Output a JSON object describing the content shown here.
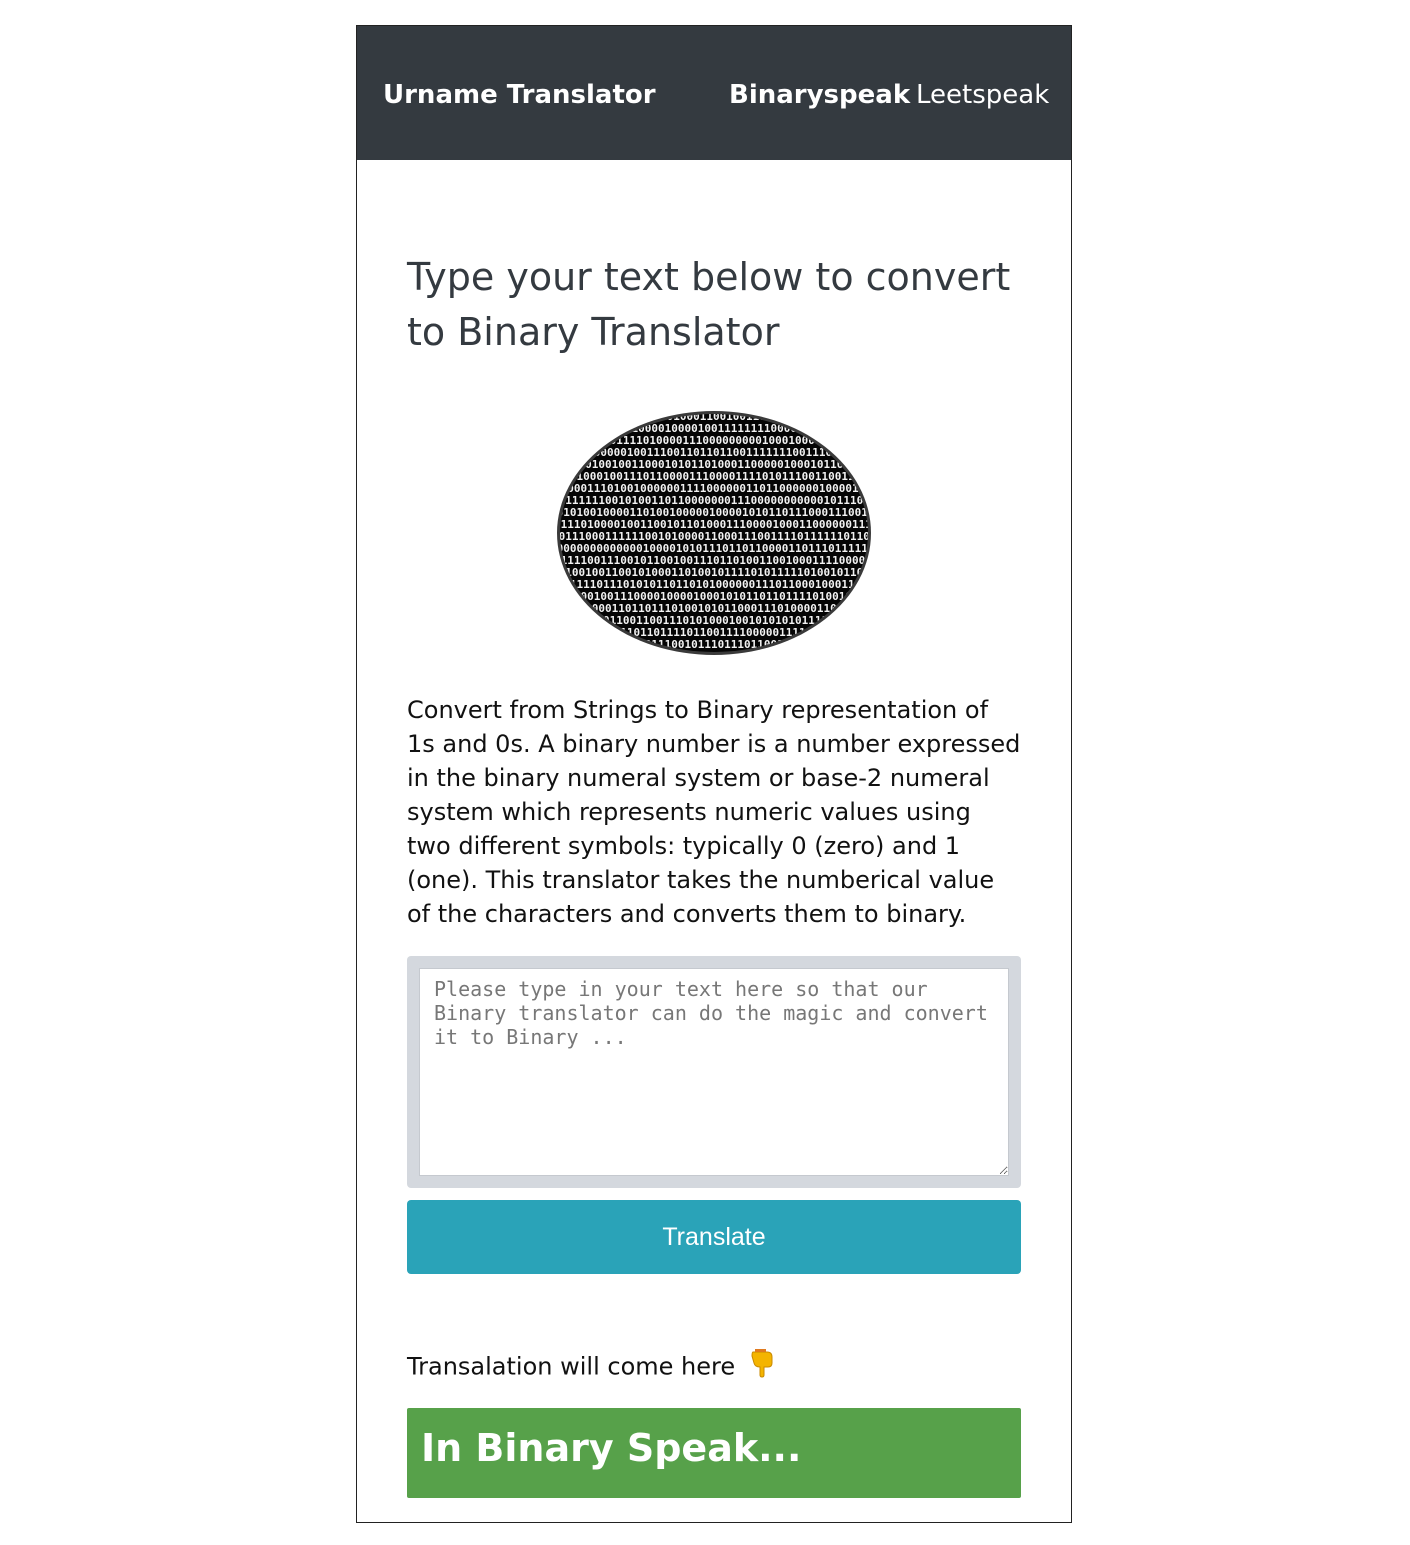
{
  "navbar": {
    "brand": "Urname Translator",
    "links": [
      {
        "label": "Binaryspeak",
        "active": true
      },
      {
        "label": "Leetspeak",
        "active": false
      }
    ],
    "background_color": "#343a40"
  },
  "main": {
    "heading": "Type your text below to convert to Binary Translator",
    "hero_image_icon": "binary-matrix-image",
    "description": "Convert from Strings to Binary representation of 1s and 0s. A binary number is a number expressed in the binary numeral system or base-2 numeral system which represents numeric values using two different symbols: typically 0 (zero) and 1 (one). This translator takes the numberical value of the characters and converts them to binary.",
    "input": {
      "value": "",
      "placeholder": "Please type in your text here so that our Binary translator can do the magic and convert it to Binary ..."
    },
    "translate_button": "Translate",
    "result_label": "Transalation will come here",
    "result_icon": "pointing-down-hand-icon",
    "output_text": "In Binary Speak..."
  },
  "colors": {
    "button": "#2aa3b8",
    "output_background": "#57a14a"
  }
}
